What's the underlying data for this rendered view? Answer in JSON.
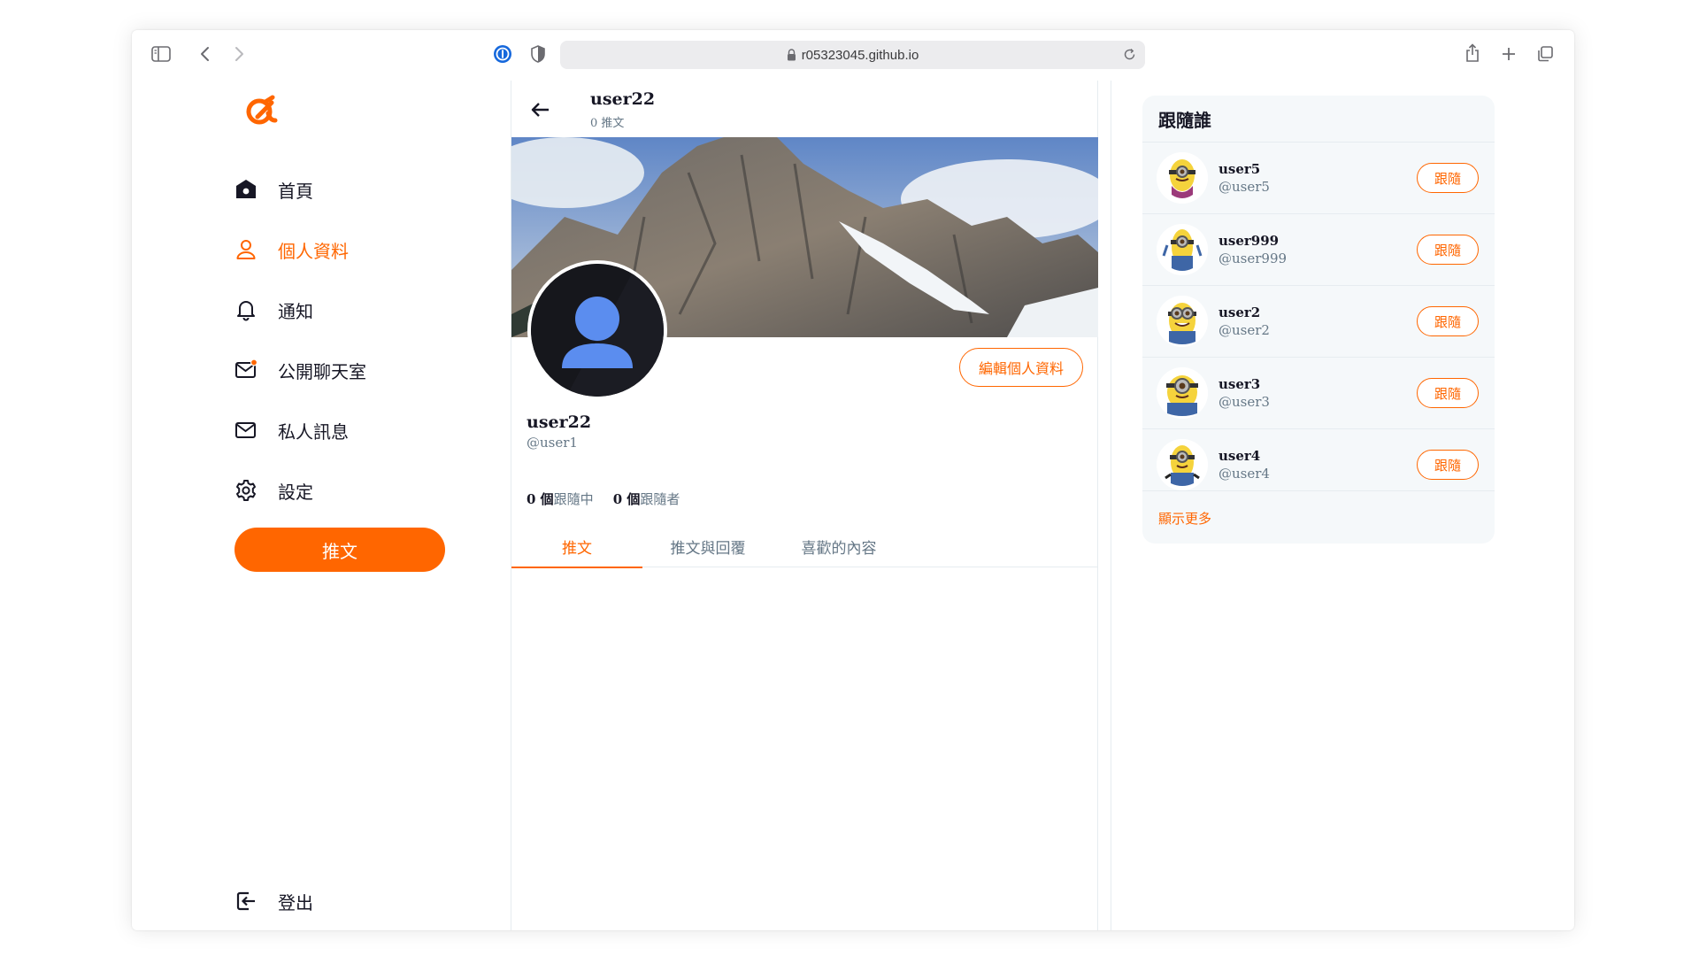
{
  "browser": {
    "url": "r05323045.github.io",
    "icons": [
      "sidebar-icon",
      "back-icon",
      "forward-icon",
      "password-icon",
      "shield-icon",
      "lock-icon",
      "reload-icon",
      "share-icon",
      "new-tab-icon",
      "tabs-overview-icon"
    ]
  },
  "brand": {
    "accent": "#ff6600",
    "text": "#171725",
    "muted": "#657786"
  },
  "nav": {
    "items": [
      {
        "label": "首頁",
        "icon": "home-icon",
        "active": false
      },
      {
        "label": "個人資料",
        "icon": "user-icon",
        "active": true
      },
      {
        "label": "通知",
        "icon": "bell-icon",
        "active": false
      },
      {
        "label": "公開聊天室",
        "icon": "mail-dot-icon",
        "active": false
      },
      {
        "label": "私人訊息",
        "icon": "mail-icon",
        "active": false
      },
      {
        "label": "設定",
        "icon": "gear-icon",
        "active": false
      }
    ],
    "tweet_button": "推文",
    "logout": "登出"
  },
  "profile": {
    "header_name": "user22",
    "header_count": "0 推文",
    "edit_button": "編輯個人資料",
    "name": "user22",
    "handle": "@user1",
    "following_count": "0 個",
    "following_label": "跟隨中",
    "followers_count": "0 個",
    "followers_label": "跟隨者",
    "tabs": [
      "推文",
      "推文與回覆",
      "喜歡的內容"
    ],
    "active_tab": 0
  },
  "suggestions": {
    "title": "跟隨誰",
    "users": [
      {
        "name": "user5",
        "handle": "@user5",
        "button": "跟隨"
      },
      {
        "name": "user999",
        "handle": "@user999",
        "button": "跟隨"
      },
      {
        "name": "user2",
        "handle": "@user2",
        "button": "跟隨"
      },
      {
        "name": "user3",
        "handle": "@user3",
        "button": "跟隨"
      },
      {
        "name": "user4",
        "handle": "@user4",
        "button": "跟隨"
      }
    ],
    "show_more": "顯示更多"
  }
}
